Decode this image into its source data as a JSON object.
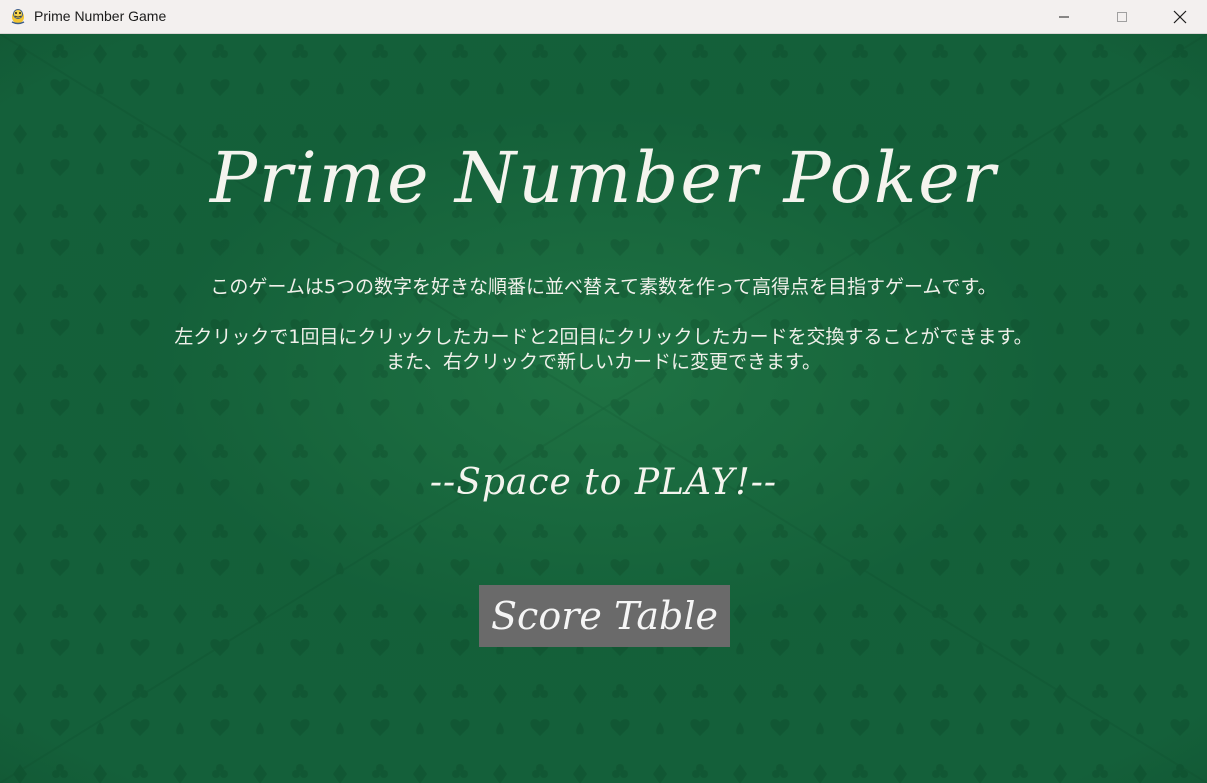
{
  "window": {
    "title": "Prime Number Game",
    "controls": [
      "minimize",
      "maximize",
      "close"
    ]
  },
  "game": {
    "title": "Prime Number Poker",
    "description_line1": "このゲームは5つの数字を好きな順番に並べ替えて素数を作って高得点を目指すゲームです。",
    "description_line2": "左クリックで1回目にクリックしたカードと2回目にクリックしたカードを交換することができます。",
    "description_line3": "また、右クリックで新しいカードに変更できます。",
    "play_prompt": "--Space to PLAY!--",
    "score_table_button": "Score Table"
  },
  "colors": {
    "background_green": "#14603a",
    "button_gray": "#6a6a6a",
    "text": "#f4f4ee"
  }
}
